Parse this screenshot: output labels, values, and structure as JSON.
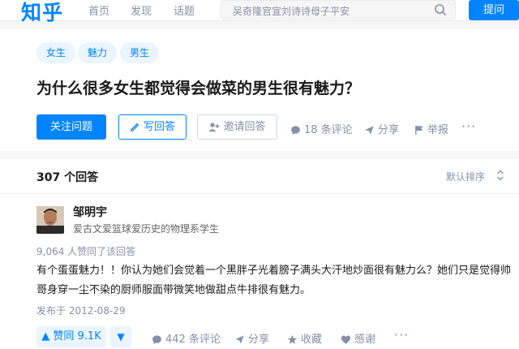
{
  "nav": {
    "logo": "知乎",
    "items": [
      "首页",
      "发现",
      "话题"
    ],
    "search_placeholder": "吴奇隆官宣刘诗诗母子平安",
    "ask_label": "提问"
  },
  "question": {
    "tags": [
      "女生",
      "魅力",
      "男生"
    ],
    "title": "为什么很多女生都觉得会做菜的男生很有魅力？",
    "follow_label": "关注问题",
    "write_label": "写回答",
    "invite_label": "邀请回答",
    "comments_label": "18 条评论",
    "share_label": "分享",
    "report_label": "举报",
    "more_label": "···"
  },
  "answers": {
    "count_label": "307 个回答",
    "sort_label": "默认排序",
    "first": {
      "author": "邹明宇",
      "bio": "爱古文爱篮球爱历史的物理系学生",
      "votes_text": "9,064 人赞同了该回答",
      "content": "有个蛋蛋魅力！！你认为她们会觉着一个黑胖子光着膀子满头大汗地炒面很有魅力么？她们只是觉得帅哥身穿一尘不染的厨师服面带微笑地做甜点牛排很有魅力。",
      "date": "发布于 2012-08-29",
      "vote_label": "▲ 赞同 9.1K",
      "vote_down": "▼",
      "comments_label": "442 条评论",
      "share_label": "分享",
      "fav_label": "收藏",
      "thanks_label": "感谢",
      "more_label": "···"
    }
  },
  "colors": {
    "accent": "#0084ff",
    "muted": "#8590a6",
    "tag_bg": "#ebf5ff",
    "page_bg": "#f6f6f6"
  }
}
